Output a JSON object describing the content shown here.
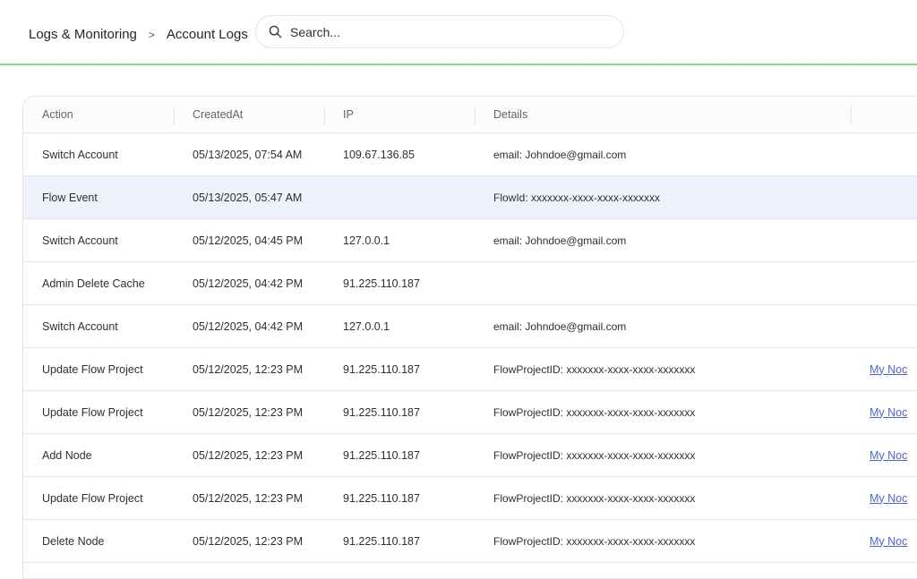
{
  "breadcrumb": {
    "parent": "Logs & Monitoring",
    "separator": ">",
    "current": "Account Logs"
  },
  "search": {
    "placeholder": "Search...",
    "icon": "search-icon"
  },
  "table": {
    "columns": [
      "Action",
      "CreatedAt",
      "IP",
      "Details",
      ""
    ],
    "rows": [
      {
        "action": "Switch Account",
        "created": "05/13/2025, 07:54 AM",
        "ip": "109.67.136.85",
        "details": "email: Johndoe@gmail.com",
        "link": "",
        "selected": false
      },
      {
        "action": "Flow Event",
        "created": "05/13/2025, 05:47 AM",
        "ip": "",
        "details": "FlowId: xxxxxxx-xxxx-xxxx-xxxxxxx",
        "link": "",
        "selected": true
      },
      {
        "action": "Switch Account",
        "created": "05/12/2025, 04:45 PM",
        "ip": "127.0.0.1",
        "details": "email: Johndoe@gmail.com",
        "link": "",
        "selected": false
      },
      {
        "action": "Admin Delete Cache",
        "created": "05/12/2025, 04:42 PM",
        "ip": "91.225.110.187",
        "details": "",
        "link": "",
        "selected": false
      },
      {
        "action": "Switch Account",
        "created": "05/12/2025, 04:42 PM",
        "ip": "127.0.0.1",
        "details": "email: Johndoe@gmail.com",
        "link": "",
        "selected": false
      },
      {
        "action": "Update Flow Project",
        "created": "05/12/2025, 12:23 PM",
        "ip": "91.225.110.187",
        "details": "FlowProjectID: xxxxxxx-xxxx-xxxx-xxxxxxx",
        "link": "My Noc",
        "selected": false
      },
      {
        "action": "Update Flow Project",
        "created": "05/12/2025, 12:23 PM",
        "ip": "91.225.110.187",
        "details": "FlowProjectID: xxxxxxx-xxxx-xxxx-xxxxxxx",
        "link": "My Noc",
        "selected": false
      },
      {
        "action": "Add Node",
        "created": "05/12/2025, 12:23 PM",
        "ip": "91.225.110.187",
        "details": "FlowProjectID: xxxxxxx-xxxx-xxxx-xxxxxxx",
        "link": "My Noc",
        "selected": false
      },
      {
        "action": "Update Flow Project",
        "created": "05/12/2025, 12:23 PM",
        "ip": "91.225.110.187",
        "details": "FlowProjectID: xxxxxxx-xxxx-xxxx-xxxxxxx",
        "link": "My Noc",
        "selected": false
      },
      {
        "action": "Delete Node",
        "created": "05/12/2025, 12:23 PM",
        "ip": "91.225.110.187",
        "details": "FlowProjectID: xxxxxxx-xxxx-xxxx-xxxxxxx",
        "link": "My Noc",
        "selected": false
      }
    ]
  },
  "colors": {
    "header_border": "#7fe07f",
    "selected_row": "#eef0fb",
    "link": "#4a63d8"
  }
}
